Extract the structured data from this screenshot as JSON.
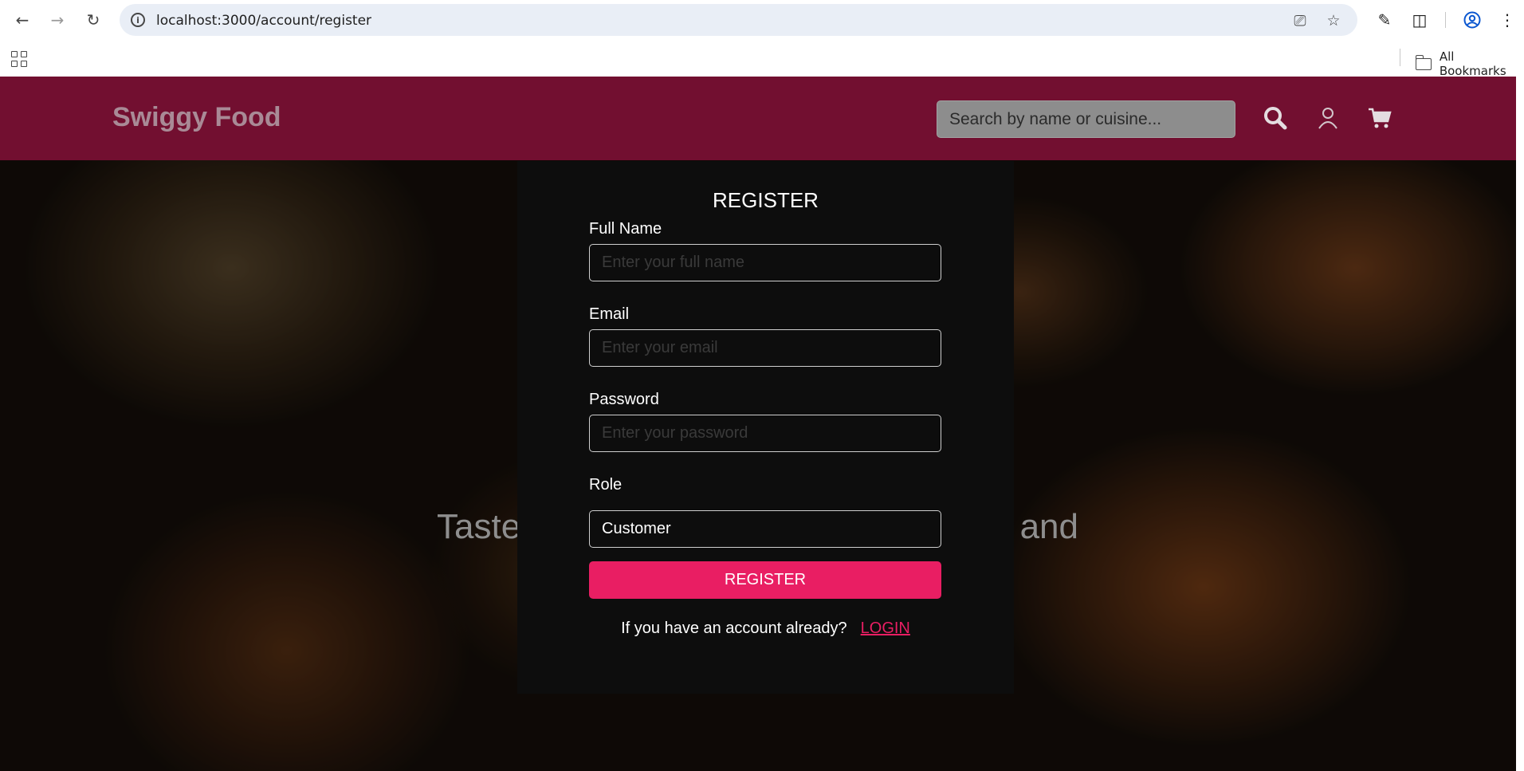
{
  "browser": {
    "url": "localhost:3000/account/register",
    "bookmarks_label": "All Bookmarks",
    "icons": [
      "back-arrow-icon",
      "forward-arrow-icon",
      "reload-icon",
      "site-info-icon",
      "install-app-icon",
      "star-icon",
      "eyedropper-icon",
      "extensions-icon",
      "profile-icon",
      "more-menu-icon",
      "apps-grid-icon",
      "folder-icon"
    ]
  },
  "header": {
    "brand": "Swiggy Food",
    "search_placeholder": "Search by name or cuisine...",
    "icons": [
      "search-icon",
      "user-icon",
      "cart-icon"
    ],
    "background": "#720f30"
  },
  "hero": {
    "text_left": "Taste",
    "text_right": "and"
  },
  "register_form": {
    "title": "REGISTER",
    "full_name_label": "Full Name",
    "full_name_placeholder": "Enter your full name",
    "email_label": "Email",
    "email_placeholder": "Enter your email",
    "password_label": "Password",
    "password_placeholder": "Enter your password",
    "role_label": "Role",
    "role_value": "Customer",
    "submit_label": "REGISTER",
    "login_prompt": "If you have an account already?",
    "login_link": "LOGIN",
    "accent": "#e91e63"
  }
}
